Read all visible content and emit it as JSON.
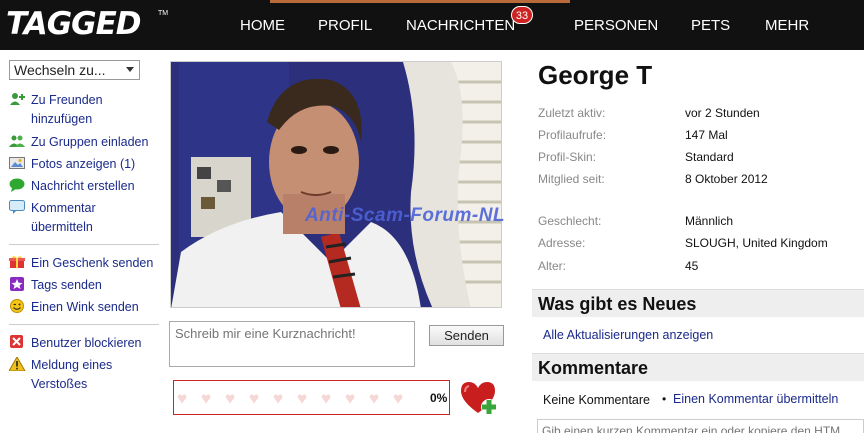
{
  "brand": {
    "logo": "TAGGED",
    "tm": "TM"
  },
  "nav": {
    "home": "HOME",
    "profil": "PROFIL",
    "nachrichten": "NACHRICHTEN",
    "nachrichten_badge": "33",
    "personen": "PERSONEN",
    "pets": "PETS",
    "mehr": "MEHR"
  },
  "sidebar": {
    "switcher_value": "Wechseln zu...",
    "items": [
      {
        "label": "Zu Freunden hinzufügen",
        "icon": "add-friend-icon"
      },
      {
        "label": "Zu Gruppen einladen",
        "icon": "group-invite-icon"
      },
      {
        "label": "Fotos anzeigen (1)",
        "icon": "photos-icon"
      },
      {
        "label": "Nachricht erstellen",
        "icon": "message-icon"
      },
      {
        "label": "Kommentar übermitteln",
        "icon": "comment-icon"
      },
      {
        "label": "Ein Geschenk senden",
        "icon": "gift-icon"
      },
      {
        "label": "Tags senden",
        "icon": "tag-star-icon"
      },
      {
        "label": "Einen Wink senden",
        "icon": "wink-icon"
      },
      {
        "label": "Benutzer blockieren",
        "icon": "block-icon"
      },
      {
        "label": "Meldung eines Verstoßes",
        "icon": "warning-icon"
      }
    ]
  },
  "watermark": "Anti-Scam-Forum-NL",
  "short_message": {
    "placeholder": "Schreib mir eine Kurznachricht!",
    "send_label": "Senden"
  },
  "meter": {
    "percent_label": "0%",
    "fill": 0
  },
  "profile": {
    "name": "George T",
    "details": [
      {
        "label": "Zuletzt aktiv:",
        "value": "vor 2 Stunden"
      },
      {
        "label": "Profilaufrufe:",
        "value": "147 Mal"
      },
      {
        "label": "Profil-Skin:",
        "value": "Standard"
      },
      {
        "label": "Mitglied seit:",
        "value": "8 Oktober 2012"
      },
      {
        "label": "Geschlecht:",
        "value": "Männlich"
      },
      {
        "label": "Adresse:",
        "value": "SLOUGH, United Kingdom"
      },
      {
        "label": "Alter:",
        "value": "45"
      }
    ]
  },
  "news": {
    "title": "Was gibt es Neues",
    "link": "Alle Aktualisierungen anzeigen"
  },
  "comments": {
    "title": "Kommentare",
    "none": "Keine Kommentare",
    "bullet": "•",
    "submit_link": "Einen Kommentar übermitteln",
    "input_placeholder": "Gib einen kurzen Kommentar ein oder kopiere den HTM"
  },
  "colors": {
    "topbar": "#111111",
    "link": "#1a2a8a",
    "badge": "#cc2222",
    "accent_red": "#cc2222"
  }
}
